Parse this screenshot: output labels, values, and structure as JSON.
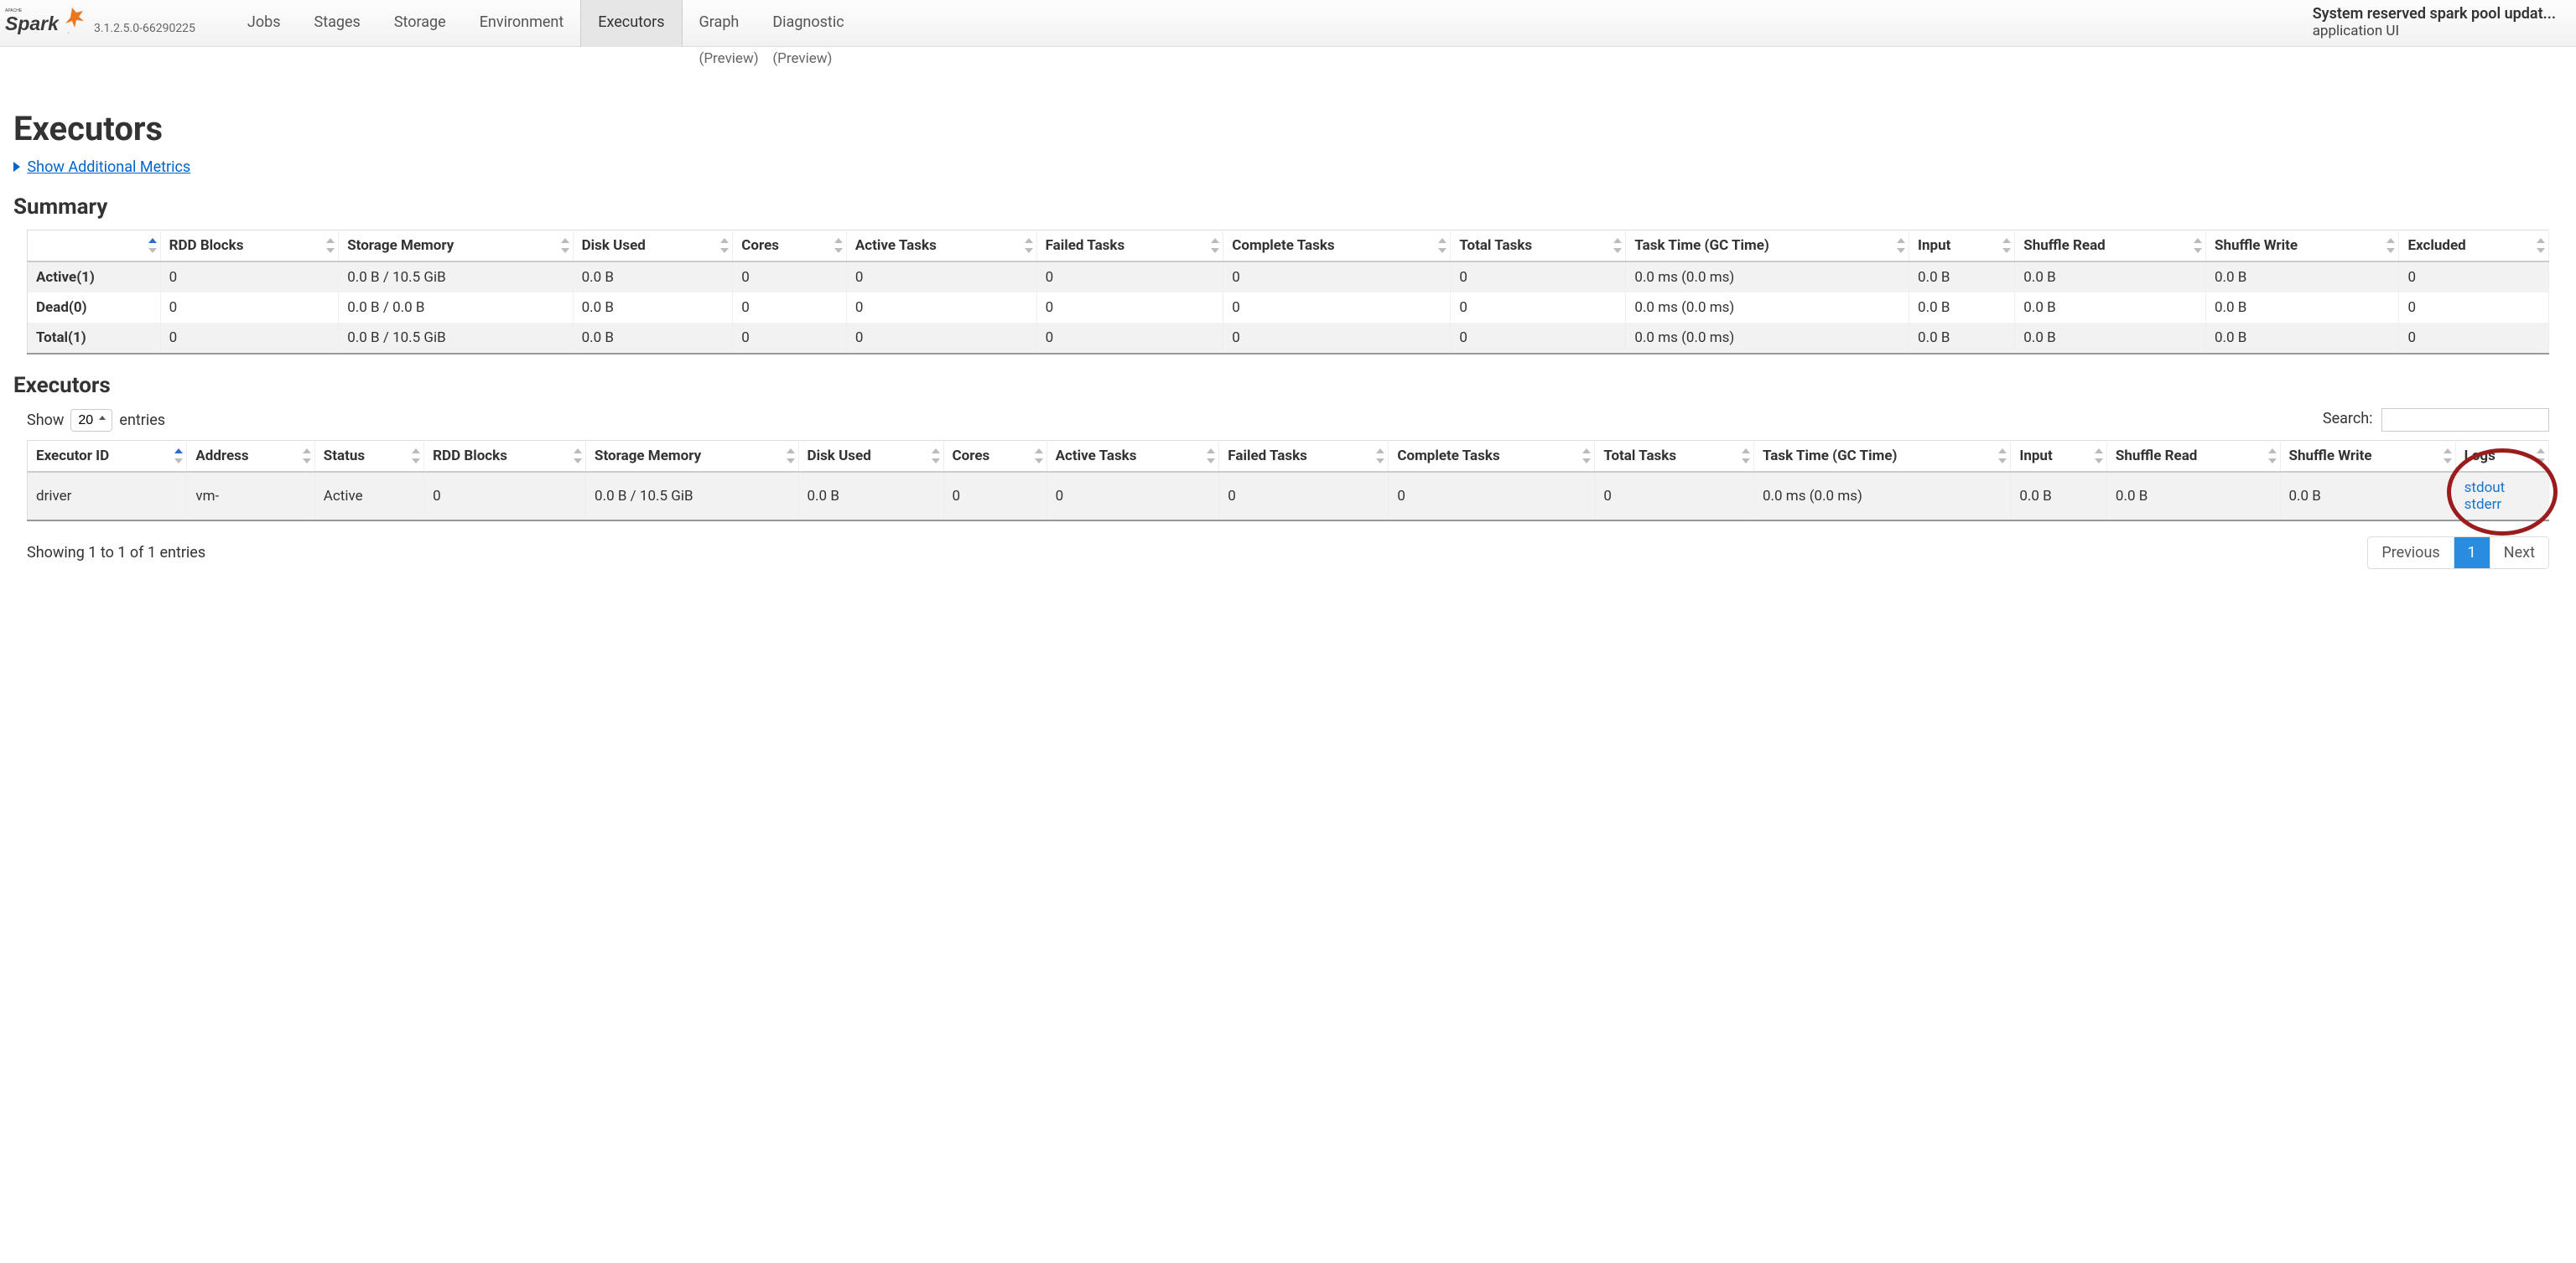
{
  "header": {
    "version": "3.1.2.5.0-66290225",
    "nav": {
      "jobs": "Jobs",
      "stages": "Stages",
      "storage": "Storage",
      "environment": "Environment",
      "executors": "Executors",
      "graph": "Graph",
      "graph_sub": "(Preview)",
      "diagnostic": "Diagnostic",
      "diagnostic_sub": "(Preview)"
    },
    "app_title": "System reserved spark pool updat...",
    "app_subtitle": "application UI"
  },
  "page": {
    "title": "Executors",
    "toggle_metrics": "Show Additional Metrics",
    "section_summary": "Summary",
    "section_executors": "Executors"
  },
  "summary": {
    "headers": {
      "blank": "",
      "rdd": "RDD Blocks",
      "storage_memory": "Storage Memory",
      "disk_used": "Disk Used",
      "cores": "Cores",
      "active_tasks": "Active Tasks",
      "failed_tasks": "Failed Tasks",
      "complete_tasks": "Complete Tasks",
      "total_tasks": "Total Tasks",
      "task_time": "Task Time (GC Time)",
      "input": "Input",
      "shuffle_read": "Shuffle Read",
      "shuffle_write": "Shuffle Write",
      "excluded": "Excluded"
    },
    "rows": [
      {
        "label": "Active(1)",
        "rdd": "0",
        "storage_memory": "0.0 B / 10.5 GiB",
        "disk_used": "0.0 B",
        "cores": "0",
        "active_tasks": "0",
        "failed_tasks": "0",
        "complete_tasks": "0",
        "total_tasks": "0",
        "task_time": "0.0 ms (0.0 ms)",
        "input": "0.0 B",
        "shuffle_read": "0.0 B",
        "shuffle_write": "0.0 B",
        "excluded": "0"
      },
      {
        "label": "Dead(0)",
        "rdd": "0",
        "storage_memory": "0.0 B / 0.0 B",
        "disk_used": "0.0 B",
        "cores": "0",
        "active_tasks": "0",
        "failed_tasks": "0",
        "complete_tasks": "0",
        "total_tasks": "0",
        "task_time": "0.0 ms (0.0 ms)",
        "input": "0.0 B",
        "shuffle_read": "0.0 B",
        "shuffle_write": "0.0 B",
        "excluded": "0"
      },
      {
        "label": "Total(1)",
        "rdd": "0",
        "storage_memory": "0.0 B / 10.5 GiB",
        "disk_used": "0.0 B",
        "cores": "0",
        "active_tasks": "0",
        "failed_tasks": "0",
        "complete_tasks": "0",
        "total_tasks": "0",
        "task_time": "0.0 ms (0.0 ms)",
        "input": "0.0 B",
        "shuffle_read": "0.0 B",
        "shuffle_write": "0.0 B",
        "excluded": "0"
      }
    ]
  },
  "executors": {
    "show_label_pre": "Show",
    "show_label_post": "entries",
    "entries_selected": "20",
    "search_label": "Search:",
    "headers": {
      "executor_id": "Executor ID",
      "address": "Address",
      "status": "Status",
      "rdd": "RDD Blocks",
      "storage_memory": "Storage Memory",
      "disk_used": "Disk Used",
      "cores": "Cores",
      "active_tasks": "Active Tasks",
      "failed_tasks": "Failed Tasks",
      "complete_tasks": "Complete Tasks",
      "total_tasks": "Total Tasks",
      "task_time": "Task Time (GC Time)",
      "input": "Input",
      "shuffle_read": "Shuffle Read",
      "shuffle_write": "Shuffle Write",
      "logs": "Logs"
    },
    "rows": [
      {
        "executor_id": "driver",
        "address": "vm-",
        "status": "Active",
        "rdd": "0",
        "storage_memory": "0.0 B / 10.5 GiB",
        "disk_used": "0.0 B",
        "cores": "0",
        "active_tasks": "0",
        "failed_tasks": "0",
        "complete_tasks": "0",
        "total_tasks": "0",
        "task_time": "0.0 ms (0.0 ms)",
        "input": "0.0 B",
        "shuffle_read": "0.0 B",
        "shuffle_write": "0.0 B",
        "logs_stdout": "stdout",
        "logs_stderr": "stderr"
      }
    ],
    "footer_info": "Showing 1 to 1 of 1 entries",
    "pager": {
      "previous": "Previous",
      "page1": "1",
      "next": "Next"
    }
  }
}
